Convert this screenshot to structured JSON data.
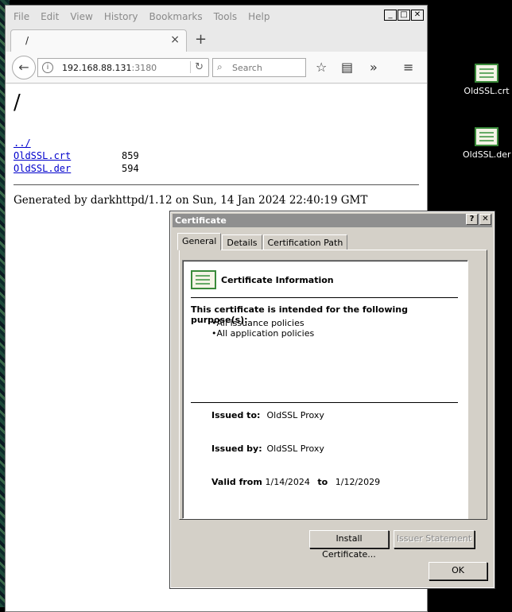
{
  "browser": {
    "menu": [
      "File",
      "Edit",
      "View",
      "History",
      "Bookmarks",
      "Tools",
      "Help"
    ],
    "window_controls": {
      "minimize": "_",
      "maximize": "□",
      "close": "✕"
    },
    "tab": {
      "title": "/",
      "close": "×",
      "new_tab": "+"
    },
    "url": {
      "host": "192.168.88.131",
      "port": ":3180"
    },
    "search_placeholder": "Search",
    "page": {
      "heading": "/",
      "parent_link": "../",
      "files": [
        {
          "name": "OldSSL.crt",
          "size": "859"
        },
        {
          "name": "OldSSL.der",
          "size": "594"
        }
      ],
      "footer": "Generated by darkhttpd/1.12 on Sun, 14 Jan 2024 22:40:19 GMT"
    }
  },
  "desktop_icons": [
    {
      "label": "OldSSL.crt",
      "icon": "certificate-icon"
    },
    {
      "label": "OldSSL.der",
      "icon": "certificate-icon"
    }
  ],
  "dialog": {
    "title": "Certificate",
    "help_btn": "?",
    "close_btn": "✕",
    "tabs": [
      "General",
      "Details",
      "Certification Path"
    ],
    "info_title": "Certificate Information",
    "purpose_heading": "This certificate is intended for the following purpose(s):",
    "purposes": [
      "•All issuance policies",
      "•All application policies"
    ],
    "issued_to_label": "Issued to:",
    "issued_to": "OldSSL Proxy",
    "issued_by_label": "Issued by:",
    "issued_by": "OldSSL Proxy",
    "valid_from_label": "Valid from",
    "valid_from": "1/14/2024",
    "valid_to_label": "to",
    "valid_to": "1/12/2029",
    "install_button": "Install Certificate...",
    "issuer_statement_button": "Issuer Statement",
    "ok_button": "OK"
  }
}
